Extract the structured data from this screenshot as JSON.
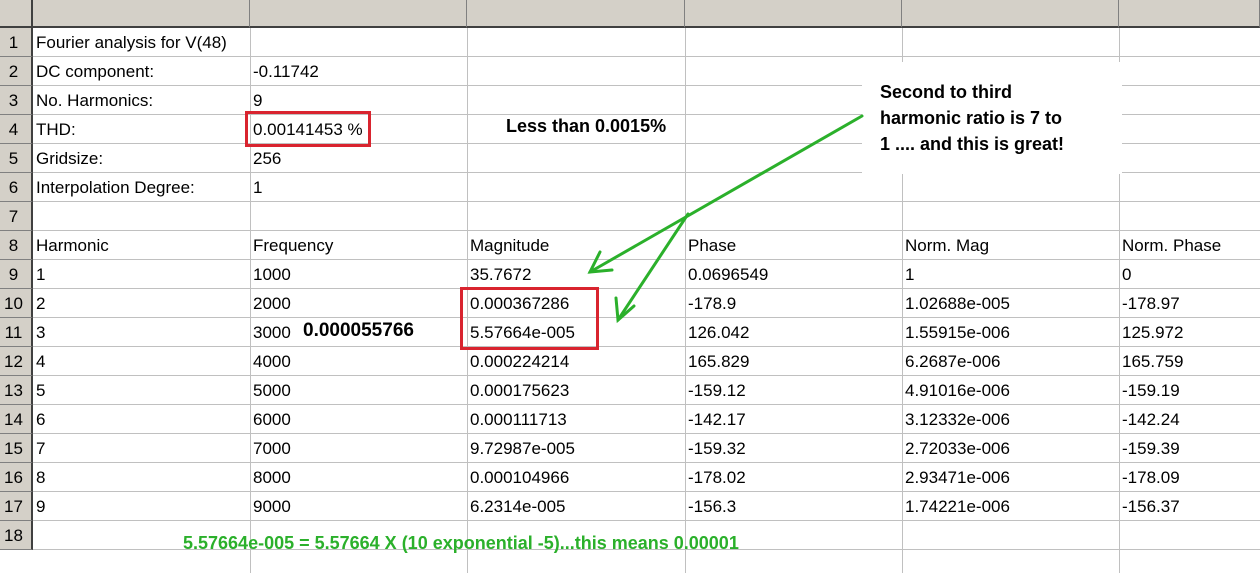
{
  "rows": [
    "1",
    "2",
    "3",
    "4",
    "5",
    "6",
    "7",
    "8",
    "9",
    "10",
    "11",
    "12",
    "13",
    "14",
    "15",
    "16",
    "17",
    "18"
  ],
  "info": [
    {
      "label": "Fourier analysis for V(48)",
      "value": ""
    },
    {
      "label": "DC component:",
      "value": "-0.11742"
    },
    {
      "label": "No. Harmonics:",
      "value": "9"
    },
    {
      "label": "THD:",
      "value": "0.00141453 %"
    },
    {
      "label": "Gridsize:",
      "value": "256"
    },
    {
      "label": "Interpolation Degree:",
      "value": "1"
    }
  ],
  "table": {
    "headers": [
      "Harmonic",
      "Frequency",
      "Magnitude",
      "Phase",
      "Norm. Mag",
      "Norm. Phase"
    ],
    "rows": [
      [
        "1",
        "1000",
        "35.7672",
        "0.0696549",
        "1",
        "0"
      ],
      [
        "2",
        "2000",
        "0.000367286",
        "-178.9",
        "1.02688e-005",
        "-178.97"
      ],
      [
        "3",
        "3000",
        "5.57664e-005",
        "126.042",
        "1.55915e-006",
        "125.972"
      ],
      [
        "4",
        "4000",
        "0.000224214",
        "165.829",
        "6.2687e-006",
        "165.759"
      ],
      [
        "5",
        "5000",
        "0.000175623",
        "-159.12",
        "4.91016e-006",
        "-159.19"
      ],
      [
        "6",
        "6000",
        "0.000111713",
        "-142.17",
        "3.12332e-006",
        "-142.24"
      ],
      [
        "7",
        "7000",
        "9.72987e-005",
        "-159.32",
        "2.72033e-006",
        "-159.39"
      ],
      [
        "8",
        "8000",
        "0.000104966",
        "-178.02",
        "2.93471e-006",
        "-178.09"
      ],
      [
        "9",
        "9000",
        "6.2314e-005",
        "-156.3",
        "1.74221e-006",
        "-156.37"
      ]
    ]
  },
  "annotations": {
    "less_than": "Less than 0.0015%",
    "callout_line1": "Second to third",
    "callout_line2": "harmonic ratio is 7 to",
    "callout_line3": "1 .... and this is great!",
    "value_note": "0.000055766",
    "footer_note": "5.57664e-005 = 5.57664 X (10 exponential -5)...this means 0.00001"
  },
  "colors": {
    "highlight_box": "#d9242f",
    "arrow": "#2bb02b",
    "header_bg": "#d4d0c8"
  }
}
